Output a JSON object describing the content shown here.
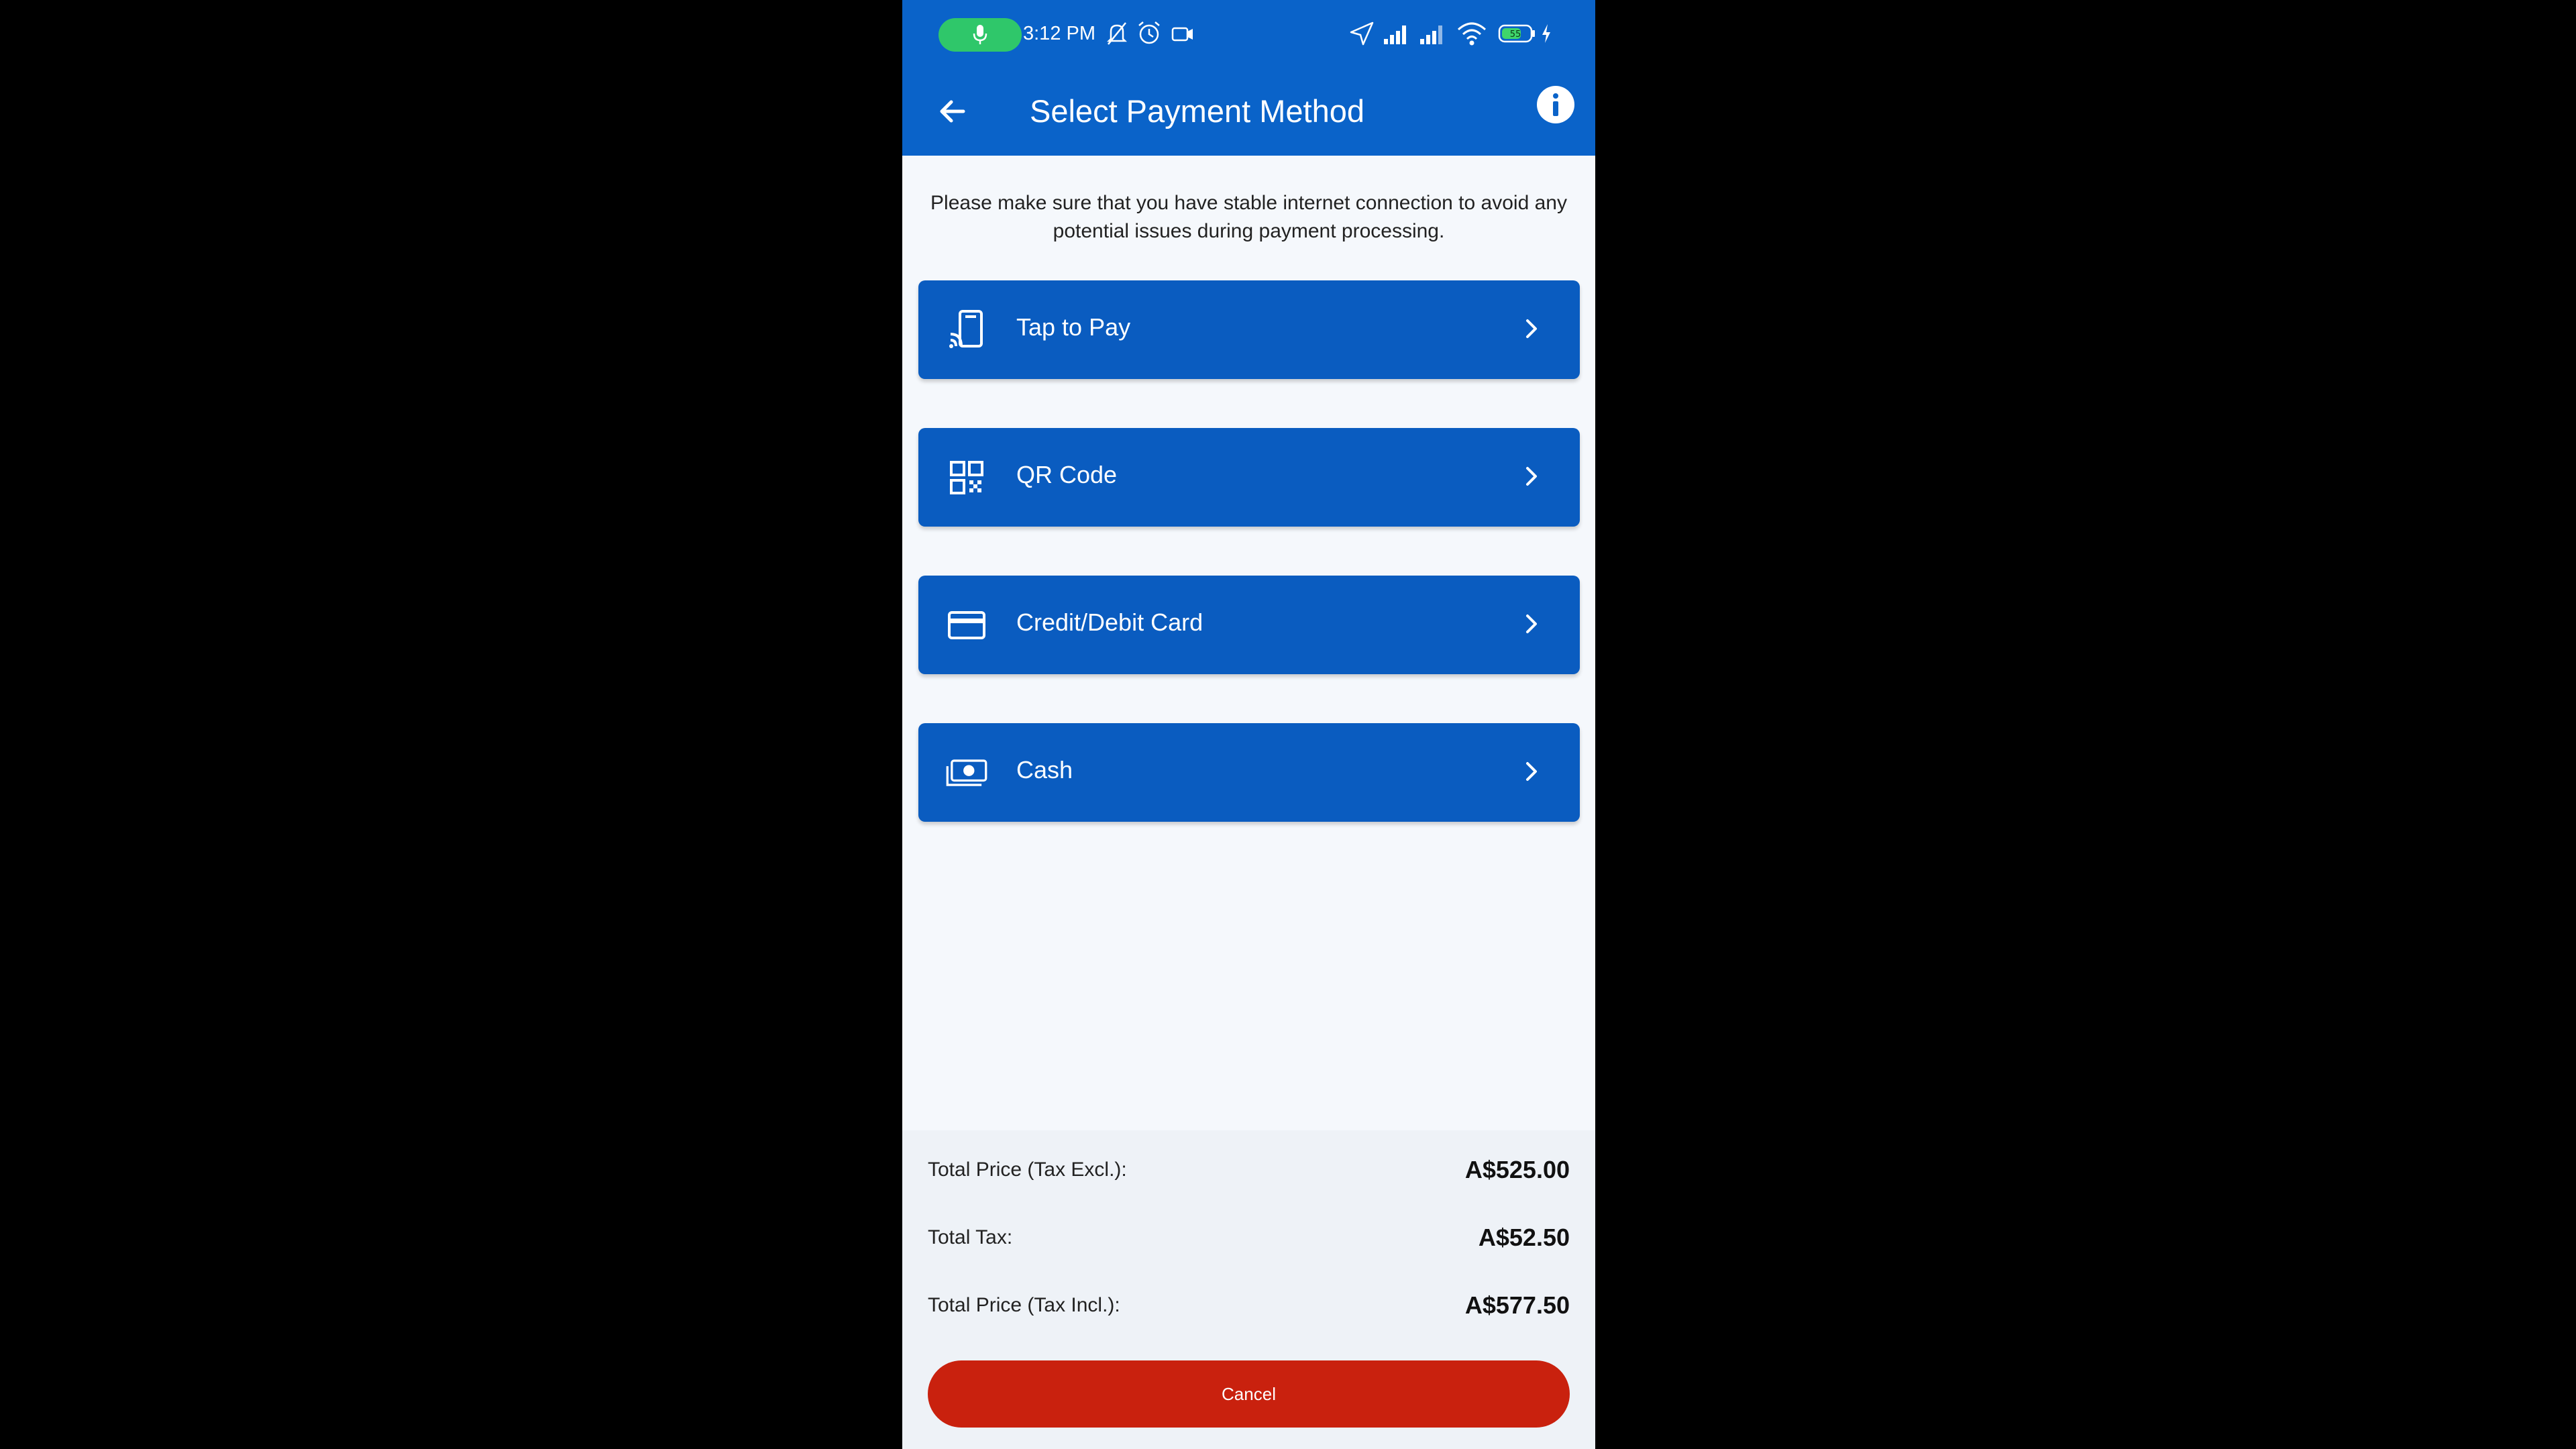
{
  "status_bar": {
    "time": "3:12 PM",
    "icons": [
      "mic-icon",
      "mute-bell-icon",
      "alarm-icon",
      "camera-icon",
      "location-arrow-icon",
      "signal-icon",
      "signal-icon",
      "wifi-icon",
      "battery-icon",
      "charging-icon"
    ],
    "battery_level": "55",
    "colors": {
      "pill": "#2fc76a",
      "bar": "#0a63c9"
    }
  },
  "app_bar": {
    "title": "Select Payment Method",
    "back_icon": "arrow-left-icon",
    "info_icon": "info-icon"
  },
  "notice": "Please make sure that you have stable internet connection to avoid any potential issues during payment processing.",
  "payment_methods": [
    {
      "label": "Tap to Pay",
      "icon": "tap-to-pay-icon"
    },
    {
      "label": "QR Code",
      "icon": "qr-code-icon"
    },
    {
      "label": "Credit/Debit Card",
      "icon": "credit-card-icon"
    },
    {
      "label": "Cash",
      "icon": "cash-icon"
    }
  ],
  "summary": {
    "total_excl_label": "Total Price (Tax Excl.):",
    "total_excl_value": "A$525.00",
    "tax_label": "Total Tax:",
    "tax_value": "A$52.50",
    "total_incl_label": "Total Price (Tax Incl.):",
    "total_incl_value": "A$577.50"
  },
  "cancel_label": "Cancel",
  "colors": {
    "primary": "#0a5cc0",
    "cancel": "#c9210e",
    "background": "#f5f8fc"
  }
}
